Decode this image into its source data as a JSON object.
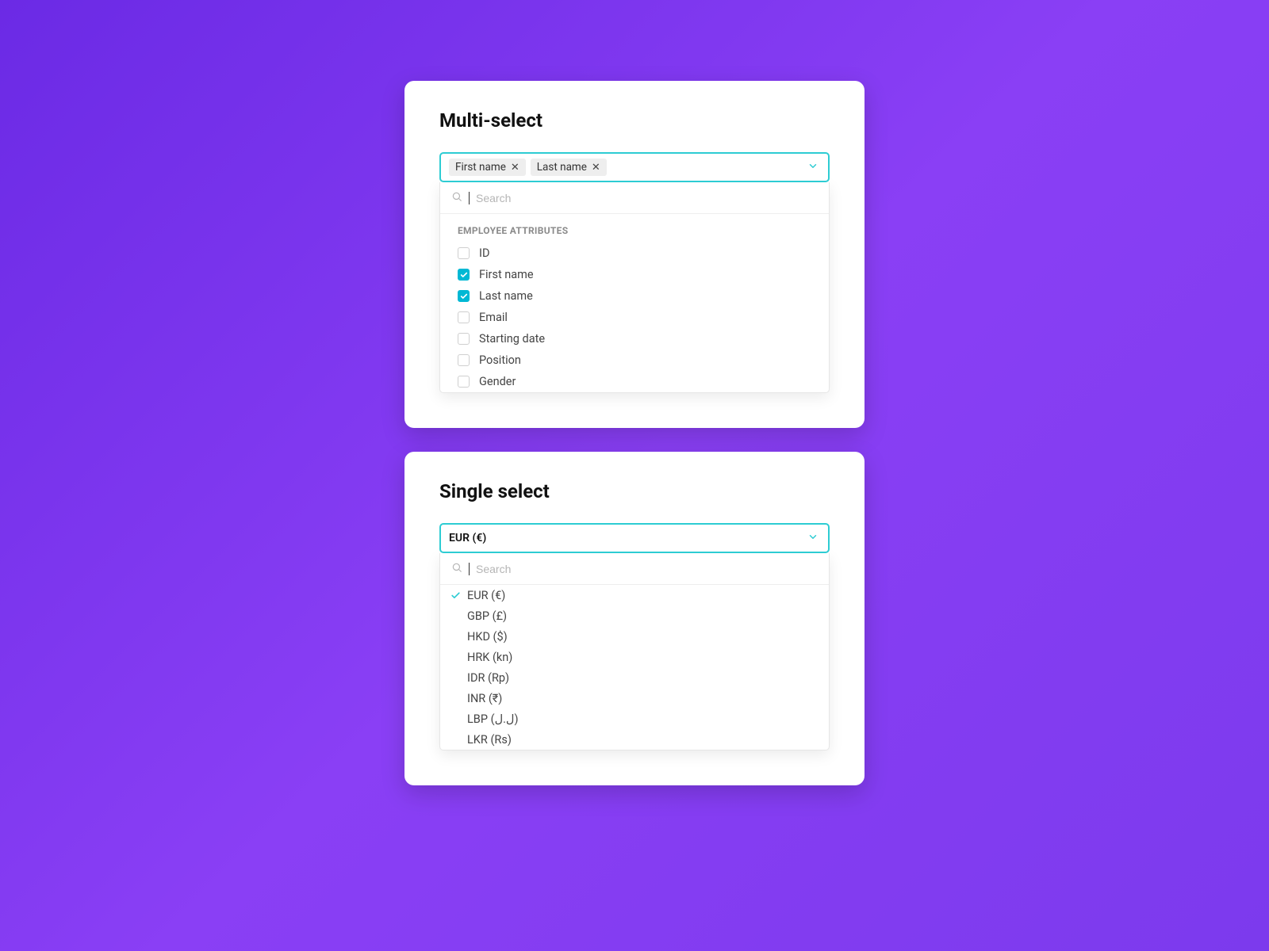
{
  "multi": {
    "title": "Multi-select",
    "selected": [
      "First name",
      "Last name"
    ],
    "search_placeholder": "Search",
    "group_label": "EMPLOYEE ATTRIBUTES",
    "options": [
      {
        "label": "ID",
        "checked": false
      },
      {
        "label": "First name",
        "checked": true
      },
      {
        "label": "Last name",
        "checked": true
      },
      {
        "label": "Email",
        "checked": false
      },
      {
        "label": "Starting date",
        "checked": false
      },
      {
        "label": "Position",
        "checked": false
      },
      {
        "label": "Gender",
        "checked": false
      }
    ]
  },
  "single": {
    "title": "Single select",
    "selected": "EUR (€)",
    "search_placeholder": "Search",
    "options": [
      {
        "label": "EUR (€)",
        "selected": true
      },
      {
        "label": "GBP (£)",
        "selected": false
      },
      {
        "label": "HKD ($)",
        "selected": false
      },
      {
        "label": "HRK (kn)",
        "selected": false
      },
      {
        "label": "IDR (Rp)",
        "selected": false
      },
      {
        "label": "INR (₹)",
        "selected": false
      },
      {
        "label": "LBP (ل.ل)",
        "selected": false
      },
      {
        "label": "LKR (Rs)",
        "selected": false
      }
    ]
  },
  "colors": {
    "accent": "#2DCCD3",
    "check": "#00B8D4"
  }
}
